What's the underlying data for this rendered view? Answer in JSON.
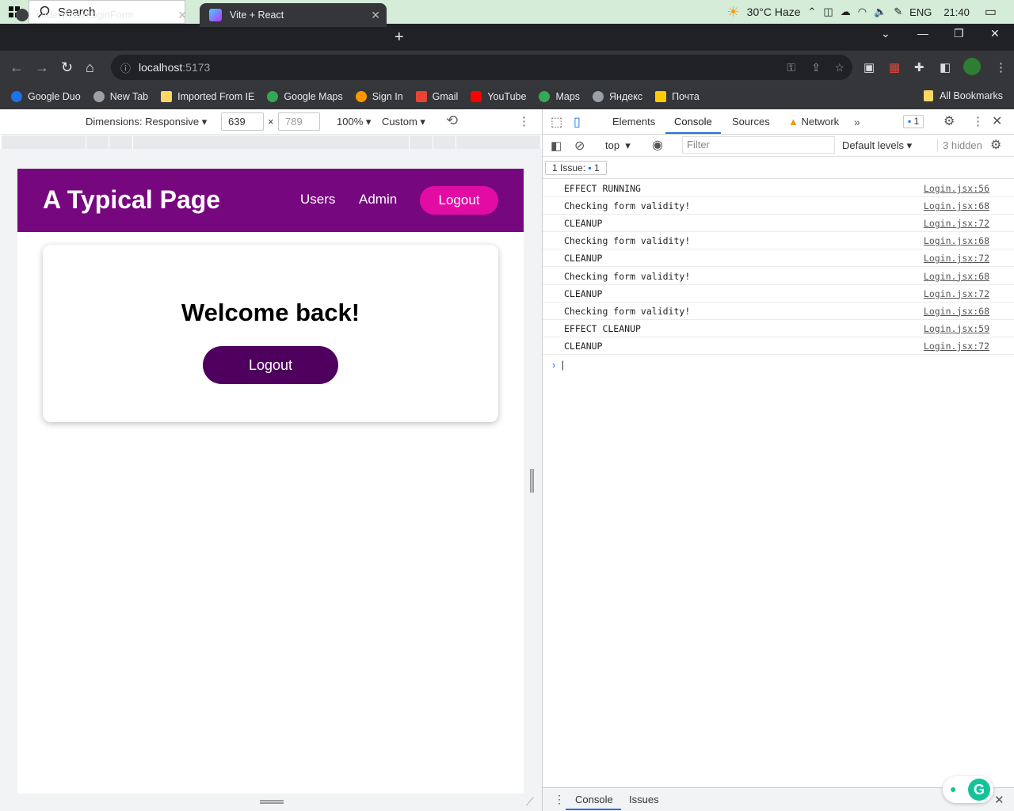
{
  "taskbar": {
    "search_placeholder": "Search",
    "weather": "30°C  Haze",
    "language": "ENG",
    "time": "21:40"
  },
  "browser": {
    "tabs": [
      {
        "title": "cadetvivek/LoginForm",
        "active": false
      },
      {
        "title": "Vite + React",
        "active": true
      }
    ],
    "address": {
      "host": "localhost",
      "port": ":5173"
    },
    "bookmarks": [
      {
        "label": "Google Duo",
        "color": "#1a73e8"
      },
      {
        "label": "New Tab",
        "color": "#9aa0a6"
      },
      {
        "label": "Imported From IE",
        "color": "#fdd663"
      },
      {
        "label": "Google Maps",
        "color": "#34a853"
      },
      {
        "label": "Sign In",
        "color": "#ff9800"
      },
      {
        "label": "Gmail",
        "color": "#ea4335"
      },
      {
        "label": "YouTube",
        "color": "#ff0000"
      },
      {
        "label": "Maps",
        "color": "#34a853"
      },
      {
        "label": "Яндекс",
        "color": "#9aa0a6"
      },
      {
        "label": "Почта",
        "color": "#ffcc00"
      }
    ],
    "all_bookmarks": "All Bookmarks"
  },
  "device_toolbar": {
    "dimensions": "Dimensions: Responsive",
    "width": "639",
    "height_placeholder": "789",
    "zoom": "100%",
    "throttle": "Custom"
  },
  "page": {
    "header_title": "A Typical Page",
    "nav": {
      "users": "Users",
      "admin": "Admin",
      "logout": "Logout"
    },
    "card_title": "Welcome back!",
    "card_button": "Logout",
    "colors": {
      "header": "#77077e",
      "nav_logout": "#e20ca4",
      "card_button": "#4f005f"
    }
  },
  "devtools": {
    "tabs": [
      "Elements",
      "Console",
      "Sources",
      "Network"
    ],
    "active_tab": "Console",
    "badge_count": "1",
    "context": "top",
    "filter_placeholder": "Filter",
    "levels": "Default levels",
    "hidden": "3 hidden",
    "issues_label": "1 Issue:",
    "issues_count": "1",
    "logs": [
      {
        "msg": "EFFECT RUNNING",
        "src": "Login.jsx:56"
      },
      {
        "msg": "Checking form validity!",
        "src": "Login.jsx:68"
      },
      {
        "msg": "CLEANUP",
        "src": "Login.jsx:72"
      },
      {
        "msg": "Checking form validity!",
        "src": "Login.jsx:68"
      },
      {
        "msg": "CLEANUP",
        "src": "Login.jsx:72"
      },
      {
        "msg": "Checking form validity!",
        "src": "Login.jsx:68"
      },
      {
        "msg": "CLEANUP",
        "src": "Login.jsx:72"
      },
      {
        "msg": "Checking form validity!",
        "src": "Login.jsx:68"
      },
      {
        "msg": "EFFECT CLEANUP",
        "src": "Login.jsx:59"
      },
      {
        "msg": "CLEANUP",
        "src": "Login.jsx:72"
      }
    ],
    "drawer_tabs": [
      "Console",
      "Issues"
    ]
  }
}
